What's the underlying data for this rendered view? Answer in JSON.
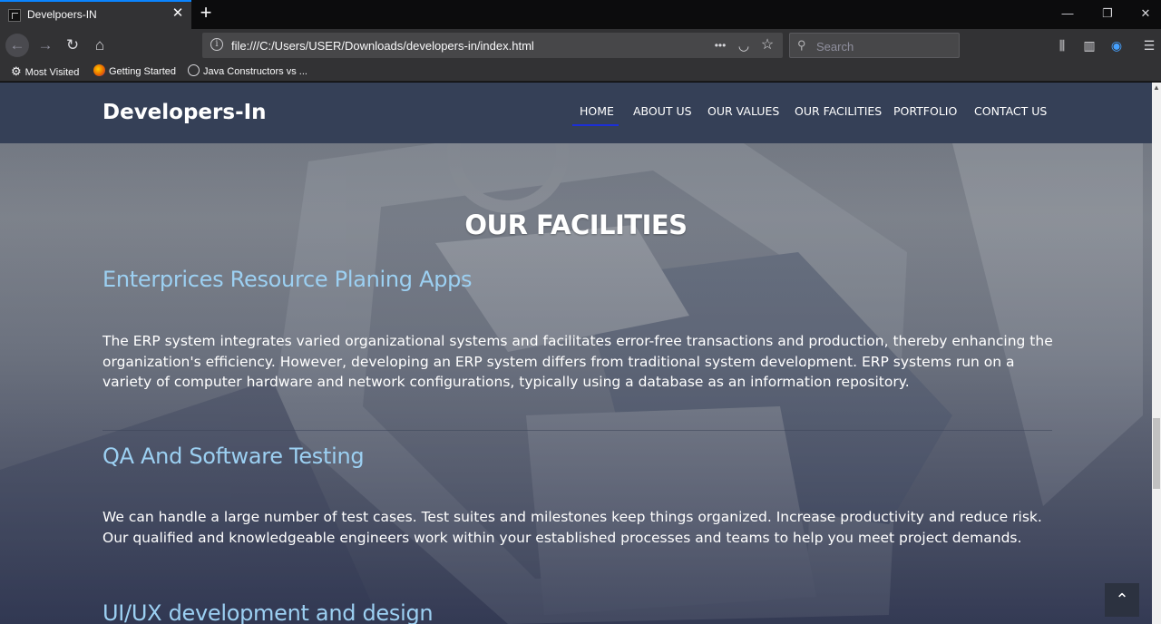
{
  "browser": {
    "tab_title": "Develpoers-IN",
    "tab_close": "✕",
    "new_tab": "+",
    "window_controls": {
      "minimize": "—",
      "restore": "❐",
      "close": "✕"
    },
    "url": "file:///C:/Users/USER/Downloads/developers-in/index.html",
    "url_info": "i",
    "url_actions": {
      "more": "•••",
      "pocket": "◡",
      "bookmark": "☆"
    },
    "search_placeholder": "Search",
    "nav": {
      "back": "←",
      "forward": "→",
      "reload": "↻",
      "home": "⌂"
    },
    "right_tools": {
      "library": "⫼",
      "sidebar": "▥",
      "account": "◉",
      "menu": "☰"
    },
    "bookmarks": [
      {
        "label": "Most Visited",
        "icon": "gear-icon",
        "glyph": "⚙"
      },
      {
        "label": "Getting Started",
        "icon": "firefox-icon",
        "color": "#e66000"
      },
      {
        "label": "Java Constructors vs ...",
        "icon": "globe-icon",
        "glyph": "🌐"
      }
    ]
  },
  "site": {
    "brand": "Developers-In",
    "menu": [
      {
        "label": "HOME",
        "active": true
      },
      {
        "label": "ABOUT US"
      },
      {
        "label": "OUR VALUES"
      },
      {
        "label": "OUR FACILITIES"
      },
      {
        "label": "PORTFOLIO"
      },
      {
        "label": "CONTACT US"
      }
    ],
    "section_title": "OUR FACILITIES",
    "facilities": [
      {
        "title": "Enterprices Resource Planing Apps",
        "description": "The ERP system integrates varied organizational systems and facilitates error-free transactions and production, thereby enhancing the organization's efficiency. However, developing an ERP system differs from traditional system development. ERP systems run on a variety of computer hardware and network configurations, typically using a database as an information repository."
      },
      {
        "title": "QA And Software Testing",
        "description": "We can handle a large number of test cases. Test suites and milestones keep things organized. Increase productivity and reduce risk. Our qualified and knowledgeable engineers work within your established processes and teams to help you meet project demands."
      },
      {
        "title": "UI/UX development and design",
        "description": ""
      }
    ],
    "back_to_top": "⌃",
    "colors": {
      "header": "#354057",
      "accent_underline": "#1c2fd8",
      "facility_title": "#9cd0f2"
    }
  }
}
